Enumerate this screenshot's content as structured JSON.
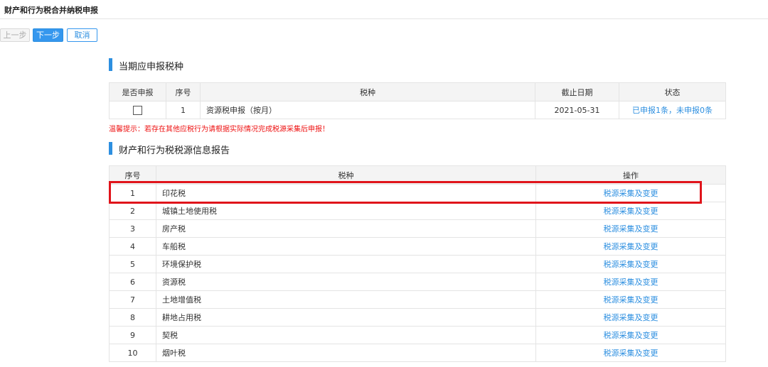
{
  "header": {
    "title": "财产和行为税合并纳税申报"
  },
  "toolbar": {
    "prev_label": "上一步",
    "next_label": "下一步",
    "cancel_label": "取消"
  },
  "section1": {
    "title": "当期应申报税种",
    "columns": [
      "是否申报",
      "序号",
      "税种",
      "截止日期",
      "状态"
    ],
    "rows": [
      {
        "no": "1",
        "tax": "资源税申报（按月）",
        "deadline": "2021-05-31",
        "status": "已申报1条，未申报0条",
        "checked": false
      }
    ]
  },
  "tip": "温馨提示：若存在其他应税行为请根据实际情况完成税源采集后申报！",
  "section2": {
    "title": "财产和行为税税源信息报告",
    "columns": [
      "序号",
      "税种",
      "操作"
    ],
    "rows": [
      {
        "no": "1",
        "tax": "印花税",
        "action": "税源采集及变更"
      },
      {
        "no": "2",
        "tax": "城镇土地使用税",
        "action": "税源采集及变更"
      },
      {
        "no": "3",
        "tax": "房产税",
        "action": "税源采集及变更"
      },
      {
        "no": "4",
        "tax": "车船税",
        "action": "税源采集及变更"
      },
      {
        "no": "5",
        "tax": "环境保护税",
        "action": "税源采集及变更"
      },
      {
        "no": "6",
        "tax": "资源税",
        "action": "税源采集及变更"
      },
      {
        "no": "7",
        "tax": "土地增值税",
        "action": "税源采集及变更"
      },
      {
        "no": "8",
        "tax": "耕地占用税",
        "action": "税源采集及变更"
      },
      {
        "no": "9",
        "tax": "契税",
        "action": "税源采集及变更"
      },
      {
        "no": "10",
        "tax": "烟叶税",
        "action": "税源采集及变更"
      }
    ]
  },
  "colors": {
    "accent": "#3597ee",
    "link": "#2d8fe0",
    "warning": "#ee1111",
    "highlight": "#e0141b"
  }
}
